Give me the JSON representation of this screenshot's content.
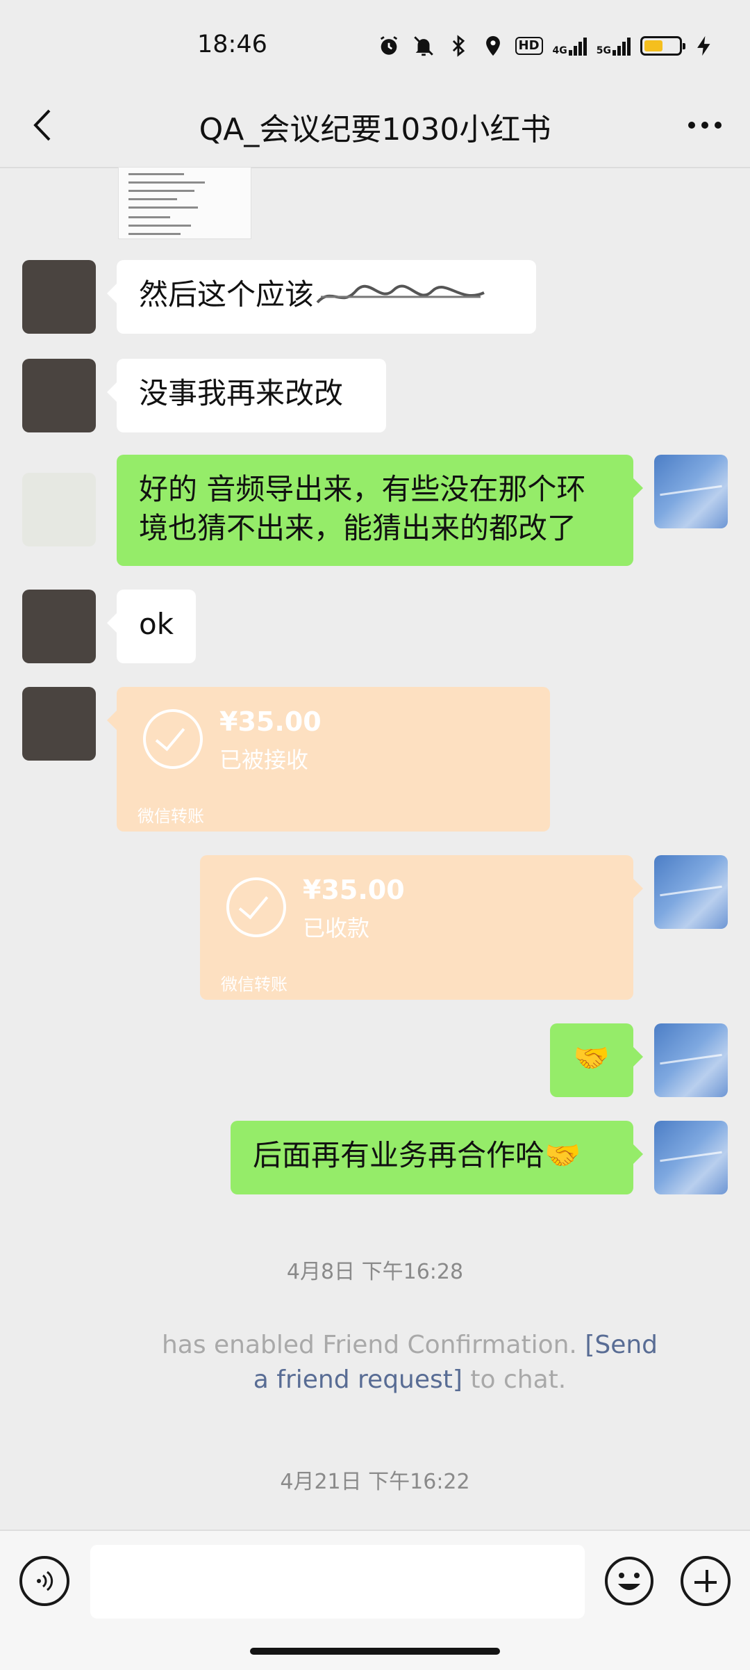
{
  "status_bar": {
    "time": "18:46",
    "hd": "HD",
    "net1": "4G",
    "net2": "5G"
  },
  "header": {
    "title": "QA_会议纪要1030小红书"
  },
  "messages": [
    {
      "side": "left",
      "text": "然后这个应该"
    },
    {
      "side": "left",
      "text": "没事我再来改改"
    },
    {
      "side": "right",
      "text": "好的 音频导出来，有些没在那个环境也猜不出来，能猜出来的都改了"
    },
    {
      "side": "left",
      "text": "ok"
    },
    {
      "side": "left",
      "type": "transfer",
      "amount": "¥35.00",
      "state": "已被接收",
      "brand": "微信转账"
    },
    {
      "side": "right",
      "type": "transfer",
      "amount": "¥35.00",
      "state": "已收款",
      "brand": "微信转账"
    },
    {
      "side": "right",
      "text": "🤝"
    },
    {
      "side": "right",
      "text": "后面再有业务再合作哈🤝"
    }
  ],
  "timestamps": [
    "4月8日 下午16:28",
    "4月21日 下午16:22"
  ],
  "system_notice": {
    "prefix": "has enabled Friend Confirmation.",
    "link": "[Send a friend request]",
    "suffix": "to chat."
  },
  "input": {
    "placeholder": ""
  },
  "colors": {
    "outgoing_bubble": "#95ec69",
    "transfer_card": "#fde0c1",
    "background": "#ededed"
  }
}
